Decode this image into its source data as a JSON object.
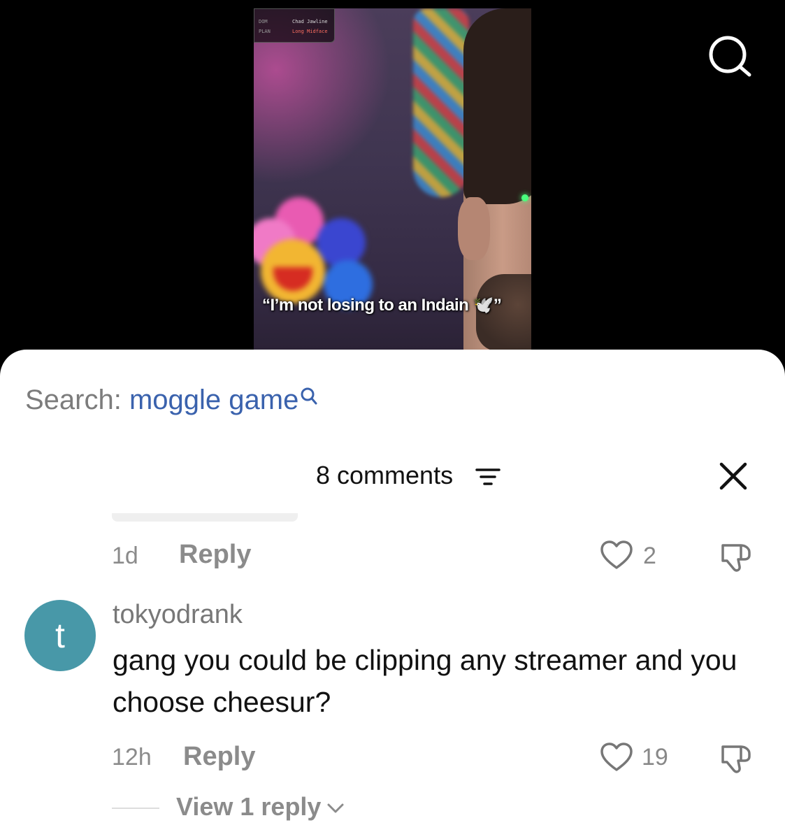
{
  "video": {
    "overlay": {
      "rows": [
        {
          "key": "DOM",
          "value": "Chad Jawline"
        },
        {
          "key": "PLAN",
          "value": "Long Midface"
        }
      ]
    },
    "caption": "“I’m not losing to an Indain 🕊️”"
  },
  "search": {
    "prefix": "Search:",
    "query": "moggle game"
  },
  "comments_header": {
    "title": "8 comments"
  },
  "comments": [
    {
      "time": "1d",
      "reply_label": "Reply",
      "likes": "2"
    },
    {
      "avatar_letter": "t",
      "username": "tokyodrank",
      "text": "gang you could be clipping any streamer and you choose cheesur?",
      "time": "12h",
      "reply_label": "Reply",
      "likes": "19",
      "view_replies": "View 1 reply"
    }
  ],
  "colors": {
    "accent_link": "#3a62ad",
    "avatar_bg": "#4898a8"
  }
}
